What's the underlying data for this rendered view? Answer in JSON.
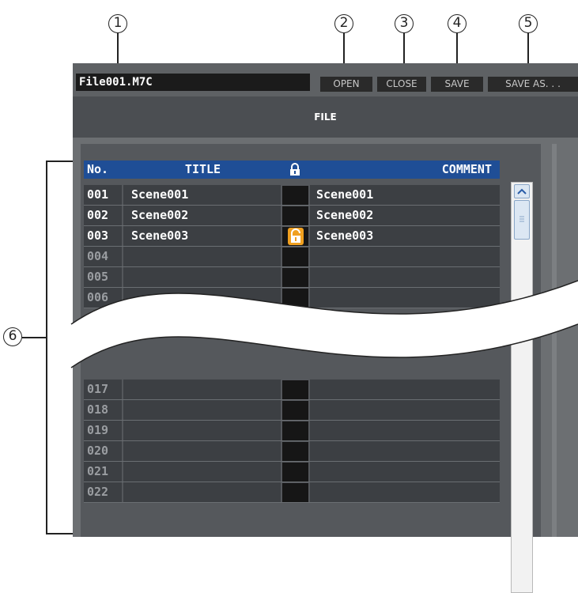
{
  "callouts": [
    "1",
    "2",
    "3",
    "4",
    "5",
    "6"
  ],
  "file_bar": {
    "filename": "File001.M7C",
    "buttons": [
      "OPEN",
      "CLOSE",
      "SAVE",
      "SAVE AS. . ."
    ]
  },
  "section_title": "FILE",
  "table": {
    "headers": {
      "no": "No.",
      "title": "TITLE",
      "lock_icon": "lock-icon",
      "comment": "COMMENT"
    },
    "rows_top": [
      {
        "no": "001",
        "title": "Scene001",
        "comment": "Scene001",
        "locked": false,
        "active": true
      },
      {
        "no": "002",
        "title": "Scene002",
        "comment": "Scene002",
        "locked": false,
        "active": true
      },
      {
        "no": "003",
        "title": "Scene003",
        "comment": "Scene003",
        "locked": true,
        "active": true
      },
      {
        "no": "004",
        "title": "",
        "comment": "",
        "locked": false,
        "active": false
      },
      {
        "no": "005",
        "title": "",
        "comment": "",
        "locked": false,
        "active": false
      },
      {
        "no": "006",
        "title": "",
        "comment": "",
        "locked": false,
        "active": false
      }
    ],
    "rows_bottom": [
      {
        "no": "017",
        "title": "",
        "comment": "",
        "locked": false,
        "active": false
      },
      {
        "no": "018",
        "title": "",
        "comment": "",
        "locked": false,
        "active": false
      },
      {
        "no": "019",
        "title": "",
        "comment": "",
        "locked": false,
        "active": false
      },
      {
        "no": "020",
        "title": "",
        "comment": "",
        "locked": false,
        "active": false
      },
      {
        "no": "021",
        "title": "",
        "comment": "",
        "locked": false,
        "active": false
      },
      {
        "no": "022",
        "title": "",
        "comment": "",
        "locked": false,
        "active": false
      }
    ]
  },
  "scrollbar": {
    "up_icon": "chevron-up-icon"
  },
  "colors": {
    "header": "#1f4e96",
    "row": "#3c3f43",
    "lock_locked": "#f0a020"
  }
}
